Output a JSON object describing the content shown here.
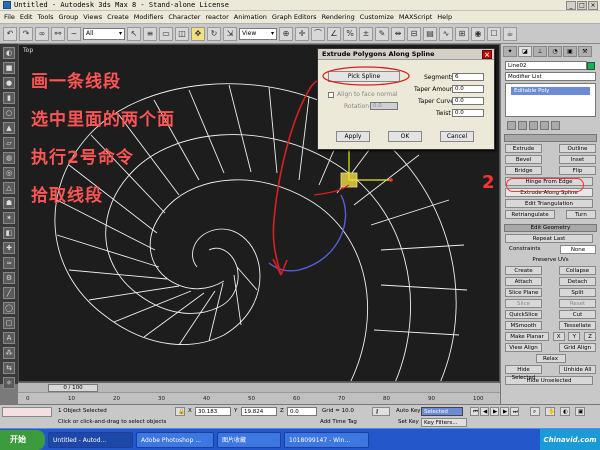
{
  "window": {
    "title": "Untitled - Autodesk 3ds Max 8  - Stand-alone License"
  },
  "menu": [
    "File",
    "Edit",
    "Tools",
    "Group",
    "Views",
    "Create",
    "Modifiers",
    "Character",
    "reactor",
    "Animation",
    "Graph Editors",
    "Rendering",
    "Customize",
    "MAXScript",
    "Help"
  ],
  "toolbar": {
    "selection_filter": "All",
    "ref_coord": "View"
  },
  "viewport": {
    "label": "Top",
    "annotations": [
      "画一条线段",
      "选中里面的两个面",
      "执行2号命令",
      "拾取线段"
    ]
  },
  "dialog": {
    "title": "Extrude Polygons Along Spline",
    "pick_spline": "Pick Spline",
    "align_label": "Align to face normal",
    "rotation_label": "Rotation",
    "rotation_value": "0.0",
    "segments_label": "Segments",
    "segments_value": "6",
    "taper_amount_label": "Taper Amount",
    "taper_amount_value": "0.0",
    "taper_curve_label": "Taper Curve",
    "taper_curve_value": "0.0",
    "twist_label": "Twist",
    "twist_value": "0.0",
    "apply": "Apply",
    "ok": "OK",
    "cancel": "Cancel"
  },
  "command_panel": {
    "object_name": "Line02",
    "modifier_list": "Modifier List",
    "stack_item": "Editable Poly",
    "marker": "2",
    "edit_polygons": {
      "extrude": "Extrude",
      "outline": "Outline",
      "bevel": "Bevel",
      "inset": "Inset",
      "bridge": "Bridge",
      "flip": "Flip",
      "hinge": "Hinge From Edge",
      "extrude_spline": "Extrude Along Spline",
      "edit_triangulation": "Edit Triangulation",
      "retriangulate": "Retriangulate",
      "turn": "Turn"
    },
    "edit_geometry": {
      "header": "Edit Geometry",
      "repeat_last": "Repeat Last",
      "constraints_label": "Constraints",
      "constraints_value": "None",
      "preserve_uvs": "Preserve UVs",
      "create": "Create",
      "collapse": "Collapse",
      "attach": "Attach",
      "detach": "Detach",
      "slice_plane": "Slice Plane",
      "split": "Split",
      "slice": "Slice",
      "reset_plane": "Reset Plane",
      "quickslice": "QuickSlice",
      "cut": "Cut",
      "msmooth": "MSmooth",
      "tessellate": "Tessellate",
      "make_planar": "Make Planar",
      "x": "X",
      "y": "Y",
      "z": "Z",
      "view_align": "View Align",
      "grid_align": "Grid Align",
      "relax": "Relax",
      "hide_selected": "Hide Selected",
      "unhide_all": "Unhide All",
      "hide_unselected": "Hide Unselected"
    }
  },
  "timeline": {
    "frame": "0 / 100",
    "ticks": [
      "0",
      "10",
      "20",
      "30",
      "40",
      "50",
      "60",
      "70",
      "80",
      "90",
      "100"
    ]
  },
  "status": {
    "selection": "1 Object Selected",
    "prompt": "Click or click-and-drag to select objects",
    "x_label": "X",
    "x_value": "30.183",
    "y_label": "Y",
    "y_value": "19.824",
    "z_label": "Z",
    "z_value": "0.0",
    "grid": "Grid = 10.0",
    "add_time_tag": "Add Time Tag",
    "auto_key": "Auto Key",
    "auto_key_value": "Selected",
    "set_key": "Set Key",
    "key_filters": "Key Filters..."
  },
  "taskbar": {
    "start": "开始",
    "tasks": [
      "Untitled - Autod...",
      "Adobe Photoshop ...",
      "图片收藏",
      "1018099147 - Win..."
    ],
    "tray": "Chinavid.com"
  }
}
